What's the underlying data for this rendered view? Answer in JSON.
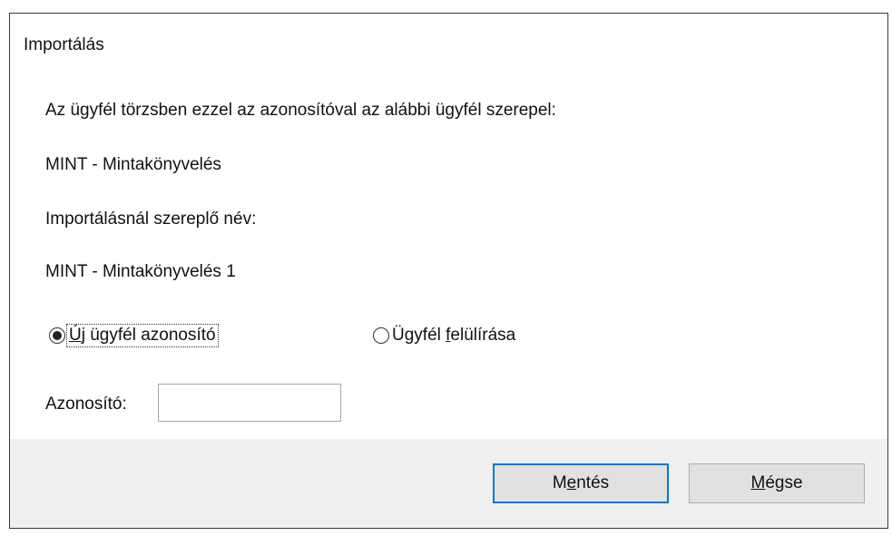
{
  "dialog": {
    "title": "Importálás",
    "intro_text": "Az ügyfél törzsben ezzel az azonosítóval az alábbi ügyfél szerepel:",
    "existing_client": "MINT - Mintakönyvelés",
    "import_name_label": "Importálásnál szereplő név:",
    "import_name": "MINT - Mintakönyvelés 1",
    "radio_new_id": {
      "label_mnemonic": "Ú",
      "label_rest": "j ügyfél azonosító",
      "selected": true
    },
    "radio_overwrite": {
      "label_pre": "Ügyfél ",
      "label_mnemonic": "f",
      "label_rest": "elülírása",
      "selected": false
    },
    "id_field": {
      "label": "Azonosító:",
      "value": "",
      "placeholder": ""
    },
    "buttons": {
      "save": {
        "pre": "M",
        "mnemonic": "e",
        "rest": "ntés"
      },
      "cancel": {
        "pre": "",
        "mnemonic": "M",
        "rest": "égse"
      }
    }
  },
  "colors": {
    "focus_border": "#0078d7",
    "footer_bg": "#f0f0f0",
    "button_bg": "#e1e1e1"
  }
}
